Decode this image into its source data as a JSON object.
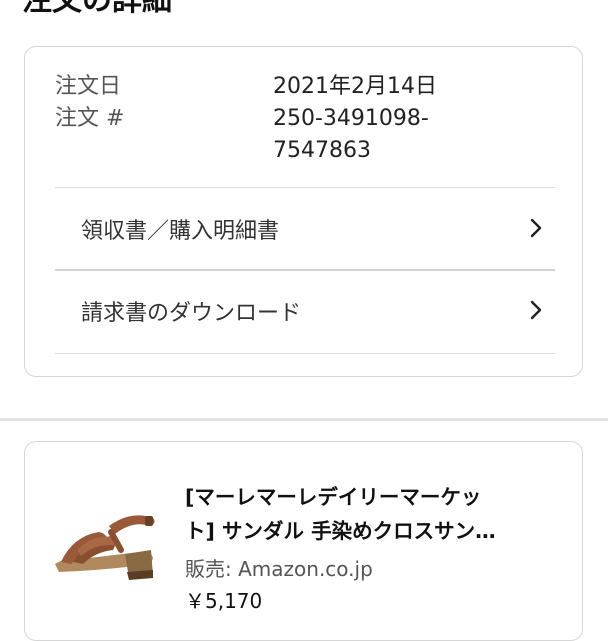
{
  "header": {
    "title": "注文の詳細"
  },
  "order": {
    "date_label": "注文日",
    "date_value": "2021年2月14日",
    "number_label": "注文 #",
    "number_value_line1": "250-3491098-",
    "number_value_line2": "7547863"
  },
  "links": {
    "receipt": "領収書／購入明細書",
    "invoice_download": "請求書のダウンロード"
  },
  "product": {
    "title_line1": "[マーレマーレデイリーマーケッ",
    "title_line2": "ト] サンダル 手染めクロスサン…",
    "seller_label": "販売:",
    "seller_name": "Amazon.co.jp",
    "price": "￥5,170",
    "image_icon": "sandal-image"
  },
  "icons": {
    "chevron": "chevron-right-icon"
  },
  "colors": {
    "border": "#d6d6d6",
    "divider": "#dcdcdc",
    "muted_text": "#555555",
    "sandal_leather": "#9a5a3a",
    "sandal_sole": "#b08a5e"
  }
}
